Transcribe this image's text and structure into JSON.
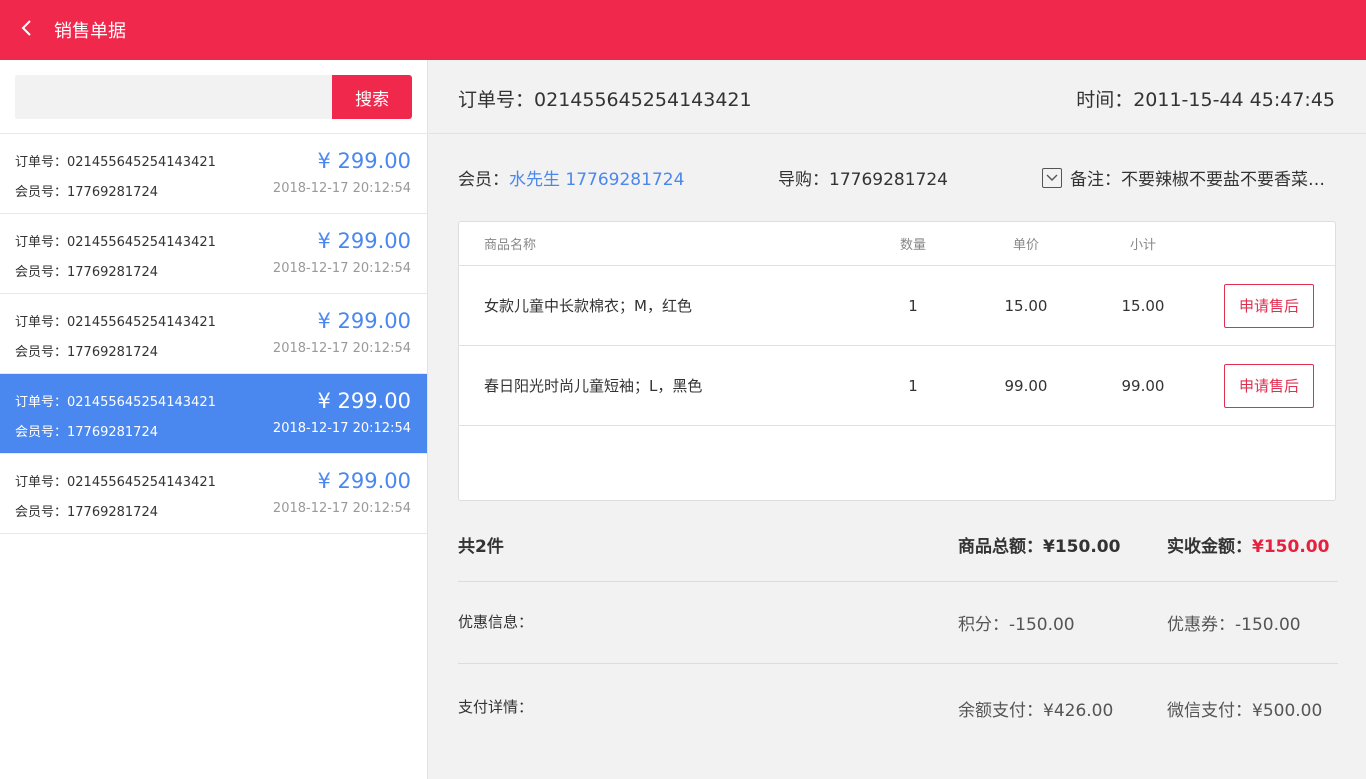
{
  "header": {
    "title": "销售单据",
    "back_icon": "chevron-left-icon"
  },
  "search": {
    "placeholder": "",
    "button_label": "搜索"
  },
  "orders": [
    {
      "order_label": "订单号：",
      "order_no": "021455645254143421",
      "member_label": "会员号：",
      "member_no": "17769281724",
      "price": "¥ 299.00",
      "time": "2018-12-17 20:12:54",
      "selected": false
    },
    {
      "order_label": "订单号：",
      "order_no": "021455645254143421",
      "member_label": "会员号：",
      "member_no": "17769281724",
      "price": "¥ 299.00",
      "time": "2018-12-17 20:12:54",
      "selected": false
    },
    {
      "order_label": "订单号：",
      "order_no": "021455645254143421",
      "member_label": "会员号：",
      "member_no": "17769281724",
      "price": "¥ 299.00",
      "time": "2018-12-17 20:12:54",
      "selected": false
    },
    {
      "order_label": "订单号：",
      "order_no": "021455645254143421",
      "member_label": "会员号：",
      "member_no": "17769281724",
      "price": "¥ 299.00",
      "time": "2018-12-17 20:12:54",
      "selected": true
    },
    {
      "order_label": "订单号：",
      "order_no": "021455645254143421",
      "member_label": "会员号：",
      "member_no": "17769281724",
      "price": "¥ 299.00",
      "time": "2018-12-17 20:12:54",
      "selected": false
    }
  ],
  "detail": {
    "order_label": "订单号：",
    "order_no": "021455645254143421",
    "time_label": "时间：",
    "time": "2011-15-44 45:47:45",
    "member_label": "会员：",
    "member_value": "水先生 17769281724",
    "guide_label": "导购：",
    "guide_value": "17769281724",
    "remark_label": "备注：",
    "remark_value": "不要辣椒不要盐不要香菜不要葱",
    "remark_icon": "chevron-down-box-icon",
    "table": {
      "headers": {
        "name": "商品名称",
        "qty": "数量",
        "price": "单价",
        "subtotal": "小计"
      },
      "rows": [
        {
          "name": "女款儿童中长款棉衣；M，红色",
          "qty": "1",
          "price": "15.00",
          "subtotal": "15.00",
          "action": "申请售后"
        },
        {
          "name": "春日阳光时尚儿童短袖；L，黑色",
          "qty": "1",
          "price": "99.00",
          "subtotal": "99.00",
          "action": "申请售后"
        }
      ]
    },
    "summary": {
      "count": "共2件",
      "goods_total_label": "商品总额：",
      "goods_total": "¥150.00",
      "received_label": "实收金额：",
      "received": "¥150.00",
      "discount_label": "优惠信息：",
      "points_label": "积分：",
      "points": "-150.00",
      "coupon_label": "优惠券：",
      "coupon": "-150.00",
      "payment_label": "支付详情：",
      "balance_label": "余额支付：",
      "balance": "¥426.00",
      "wechat_label": "微信支付：",
      "wechat": "¥500.00"
    }
  },
  "colors": {
    "brand": "#f0294c",
    "selected": "#4a87ee",
    "accent_red": "#e8203f"
  }
}
